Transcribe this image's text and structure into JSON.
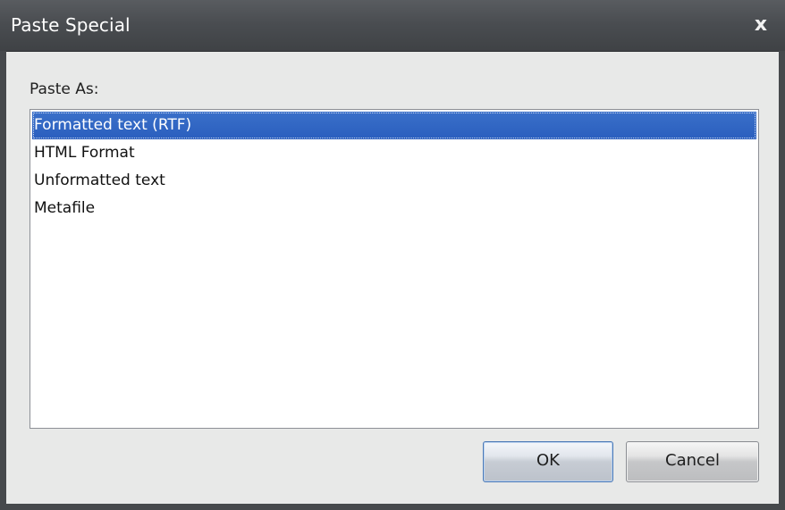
{
  "window": {
    "title": "Paste Special",
    "close_glyph": "x",
    "close_icon": "close-icon"
  },
  "paste_as": {
    "label": "Paste As:",
    "items": [
      {
        "label": "Formatted text (RTF)",
        "selected": true
      },
      {
        "label": "HTML Format",
        "selected": false
      },
      {
        "label": "Unformatted text",
        "selected": false
      },
      {
        "label": "Metafile",
        "selected": false
      }
    ]
  },
  "buttons": {
    "ok_label": "OK",
    "cancel_label": "Cancel"
  },
  "colors": {
    "selection": "#2f63c2",
    "titlebar": "#4a4d51",
    "client_bg": "#e8e9e8"
  }
}
